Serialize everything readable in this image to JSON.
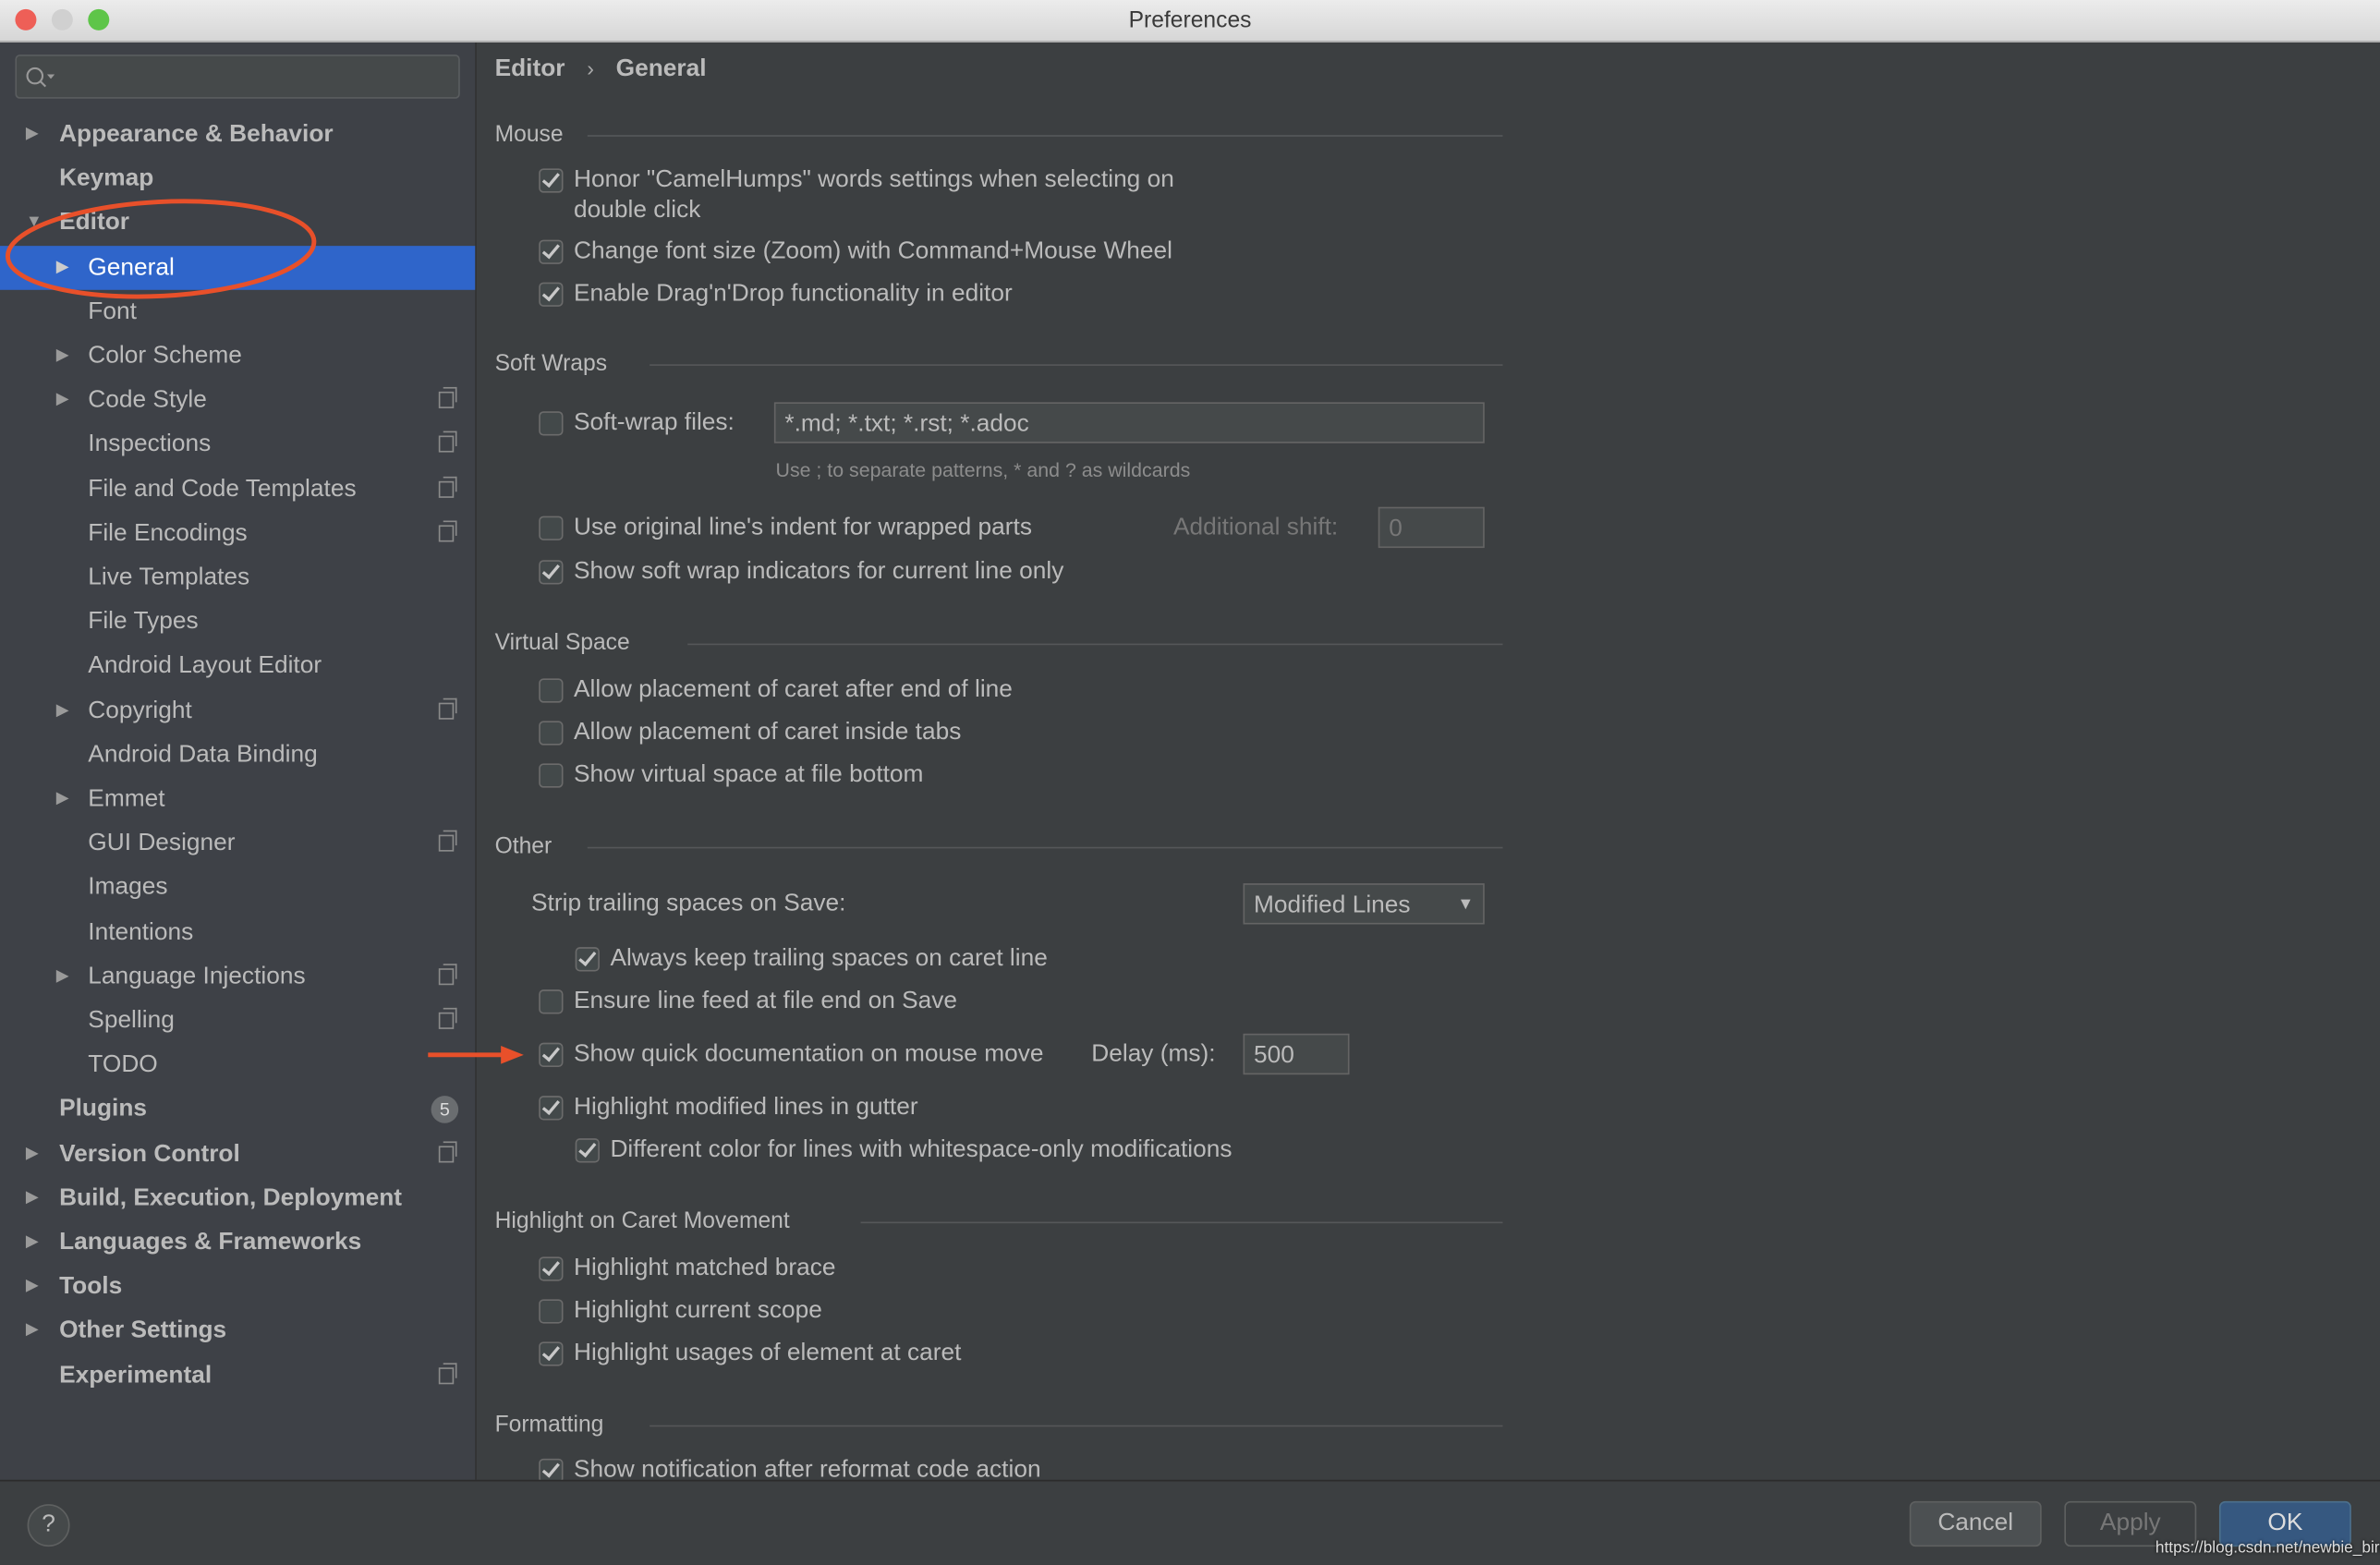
{
  "window": {
    "title": "Preferences"
  },
  "sidebar": {
    "search": {
      "placeholder": "",
      "icon": "search-icon"
    },
    "items": [
      {
        "label": "Appearance & Behavior",
        "level": 0,
        "arrow": "right",
        "bold": true
      },
      {
        "label": "Keymap",
        "level": 0,
        "bold": true
      },
      {
        "label": "Editor",
        "level": 0,
        "arrow": "down",
        "bold": true
      },
      {
        "label": "General",
        "level": 1,
        "arrow": "right",
        "selected": true
      },
      {
        "label": "Font",
        "level": 1
      },
      {
        "label": "Color Scheme",
        "level": 1,
        "arrow": "right"
      },
      {
        "label": "Code Style",
        "level": 1,
        "arrow": "right",
        "copy": true
      },
      {
        "label": "Inspections",
        "level": 1,
        "copy": true
      },
      {
        "label": "File and Code Templates",
        "level": 1,
        "copy": true
      },
      {
        "label": "File Encodings",
        "level": 1,
        "copy": true
      },
      {
        "label": "Live Templates",
        "level": 1
      },
      {
        "label": "File Types",
        "level": 1
      },
      {
        "label": "Android Layout Editor",
        "level": 1
      },
      {
        "label": "Copyright",
        "level": 1,
        "arrow": "right",
        "copy": true
      },
      {
        "label": "Android Data Binding",
        "level": 1
      },
      {
        "label": "Emmet",
        "level": 1,
        "arrow": "right"
      },
      {
        "label": "GUI Designer",
        "level": 1,
        "copy": true
      },
      {
        "label": "Images",
        "level": 1
      },
      {
        "label": "Intentions",
        "level": 1
      },
      {
        "label": "Language Injections",
        "level": 1,
        "arrow": "right",
        "copy": true
      },
      {
        "label": "Spelling",
        "level": 1,
        "copy": true
      },
      {
        "label": "TODO",
        "level": 1
      },
      {
        "label": "Plugins",
        "level": 0,
        "bold": true,
        "badge": "5"
      },
      {
        "label": "Version Control",
        "level": 0,
        "arrow": "right",
        "bold": true,
        "copy": true
      },
      {
        "label": "Build, Execution, Deployment",
        "level": 0,
        "arrow": "right",
        "bold": true
      },
      {
        "label": "Languages & Frameworks",
        "level": 0,
        "arrow": "right",
        "bold": true
      },
      {
        "label": "Tools",
        "level": 0,
        "arrow": "right",
        "bold": true
      },
      {
        "label": "Other Settings",
        "level": 0,
        "arrow": "right",
        "bold": true
      },
      {
        "label": "Experimental",
        "level": 0,
        "bold": true,
        "copy": true
      }
    ]
  },
  "breadcrumb": {
    "parent": "Editor",
    "separator": "›",
    "current": "General"
  },
  "main": {
    "items": [
      {
        "type": "header",
        "label": "Mouse"
      },
      {
        "type": "checkbox",
        "checked": true,
        "label": "Honor \"CamelHumps\" words settings when selecting on",
        "label2": "double click"
      },
      {
        "type": "checkbox",
        "checked": true,
        "label": "Change font size (Zoom) with Command+Mouse Wheel"
      },
      {
        "type": "checkbox",
        "checked": true,
        "label": "Enable Drag'n'Drop functionality in editor"
      },
      {
        "type": "header",
        "label": "Soft Wraps"
      },
      {
        "type": "checkbox",
        "checked": false,
        "label": "Soft-wrap files:",
        "input": "*.md; *.txt; *.rst; *.adoc"
      },
      {
        "type": "hint",
        "label": "Use ; to separate patterns, * and ? as wildcards"
      },
      {
        "type": "checkbox",
        "checked": false,
        "label": "Use original line's indent for wrapped parts",
        "extra_label": "Additional shift:",
        "input": "0",
        "input_disabled": true
      },
      {
        "type": "checkbox",
        "checked": true,
        "label": "Show soft wrap indicators for current line only"
      },
      {
        "type": "header",
        "label": "Virtual Space"
      },
      {
        "type": "checkbox",
        "checked": false,
        "label": "Allow placement of caret after end of line"
      },
      {
        "type": "checkbox",
        "checked": false,
        "label": "Allow placement of caret inside tabs"
      },
      {
        "type": "checkbox",
        "checked": false,
        "label": "Show virtual space at file bottom"
      },
      {
        "type": "header",
        "label": "Other"
      },
      {
        "type": "select",
        "label": "Strip trailing spaces on Save:",
        "value": "Modified Lines"
      },
      {
        "type": "checkbox",
        "checked": true,
        "indent": true,
        "label": "Always keep trailing spaces on caret line"
      },
      {
        "type": "checkbox",
        "checked": false,
        "label": "Ensure line feed at file end on Save"
      },
      {
        "type": "checkbox",
        "checked": true,
        "label": "Show quick documentation on mouse move",
        "extra_label": "Delay (ms):",
        "input": "500"
      },
      {
        "type": "checkbox",
        "checked": true,
        "label": "Highlight modified lines in gutter"
      },
      {
        "type": "checkbox",
        "checked": true,
        "indent": true,
        "label": "Different color for lines with whitespace-only modifications"
      },
      {
        "type": "header",
        "label": "Highlight on Caret Movement"
      },
      {
        "type": "checkbox",
        "checked": true,
        "label": "Highlight matched brace"
      },
      {
        "type": "checkbox",
        "checked": false,
        "label": "Highlight current scope"
      },
      {
        "type": "checkbox",
        "checked": true,
        "label": "Highlight usages of element at caret"
      },
      {
        "type": "header",
        "label": "Formatting"
      },
      {
        "type": "checkbox",
        "checked": true,
        "label": "Show notification after reformat code action"
      }
    ]
  },
  "footer": {
    "help": "?",
    "cancel": "Cancel",
    "apply": "Apply",
    "ok": "OK"
  },
  "watermark": "https://blog.csdn.net/newbie_bird",
  "colors": {
    "selection": "#2f65ca",
    "annotation": "#e8502a",
    "ok_button": "#365880"
  }
}
